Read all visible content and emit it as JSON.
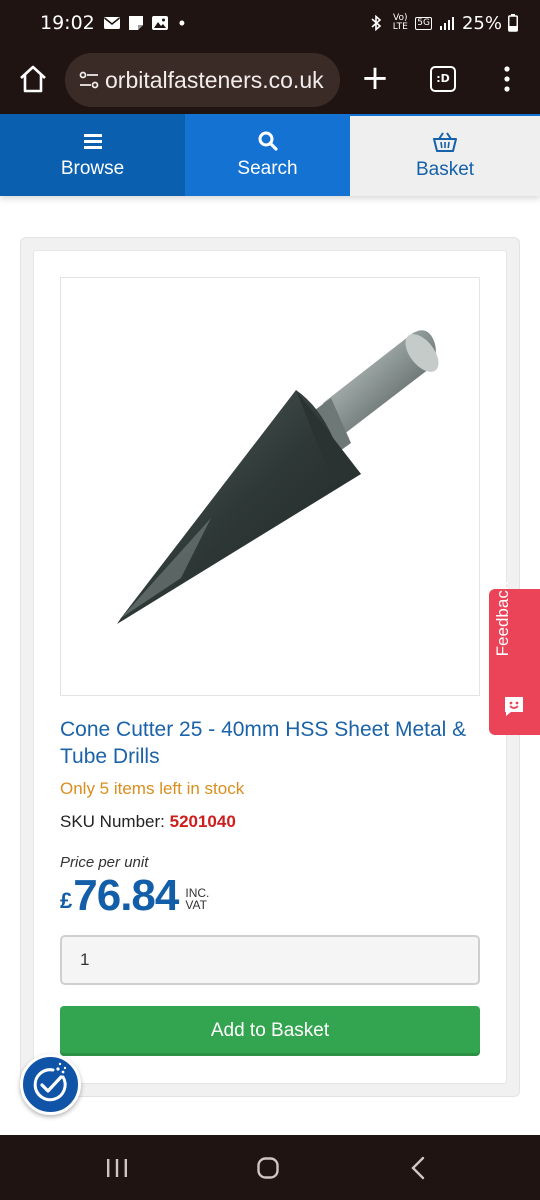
{
  "status_bar": {
    "time": "19:02",
    "dot": "•",
    "volte_label": "Vo) LTE",
    "network_label": "5G",
    "battery_text": "25%"
  },
  "browser": {
    "url_text": "orbitalfasteners.co.uk",
    "tabs_label": ":D"
  },
  "site_nav": {
    "browse_label": "Browse",
    "search_label": "Search",
    "basket_label": "Basket"
  },
  "product": {
    "title": "Cone Cutter 25 - 40mm HSS Sheet Metal & Tube Drills",
    "stock_text": "Only 5 items left in stock",
    "sku_label": "SKU Number:",
    "sku_value": "5201040",
    "price_label": "Price per unit",
    "currency": "£",
    "price": "76.84",
    "vat_line1": "INC.",
    "vat_line2": "VAT",
    "quantity": "1",
    "add_button_label": "Add to Basket"
  },
  "feedback": {
    "label": "Feedback"
  },
  "colors": {
    "brand_blue": "#0a5fae",
    "search_blue": "#1473d2",
    "stock_orange": "#d98e1e",
    "sku_red": "#cf1c1c",
    "add_green": "#33a44f",
    "feedback_red": "#eb4358",
    "chrome_dark": "#1f1411"
  },
  "icons": {
    "home": "home-icon",
    "site_settings": "tune-icon",
    "new_tab": "plus-icon",
    "tabs": "tabs-icon",
    "menu": "more-vert-icon",
    "browse": "hamburger-icon",
    "search": "search-icon",
    "basket": "basket-icon",
    "feedback": "smiley-icon",
    "accessibility": "accessibility-icon",
    "recents": "recents-icon",
    "home_nav": "home-nav-icon",
    "back": "back-icon"
  }
}
